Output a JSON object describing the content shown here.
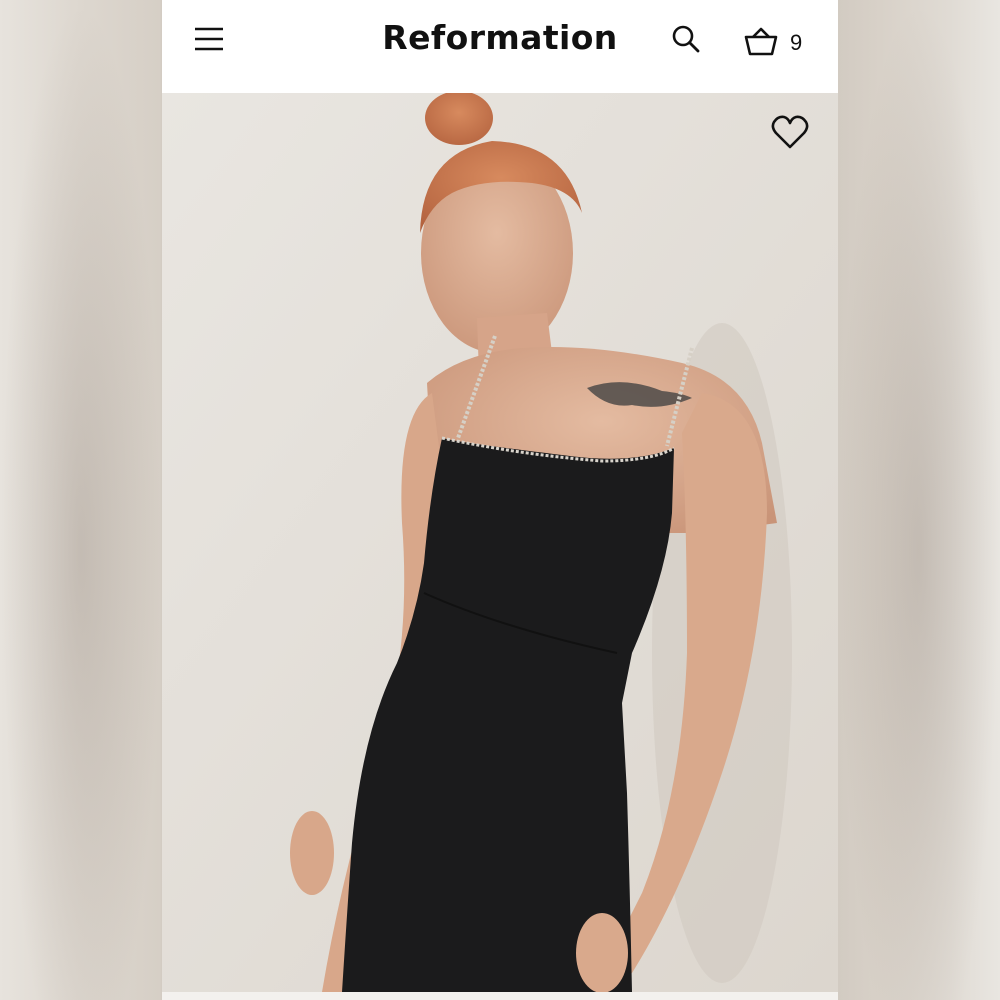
{
  "header": {
    "brand": "Reformation",
    "cart_count": "9",
    "icons": {
      "menu": "hamburger-menu-icon",
      "search": "search-icon",
      "cart": "basket-icon"
    }
  },
  "product": {
    "image": {
      "subject": "model-in-black-mini-dress",
      "colors": {
        "dress": "#1b1b1c",
        "skin": "#dcae92",
        "hair": "#c8734c",
        "backdrop": "#e5e1db"
      }
    },
    "favorite_icon": "heart-outline-icon"
  },
  "colors": {
    "header_bg": "#ffffff",
    "text": "#111111"
  }
}
